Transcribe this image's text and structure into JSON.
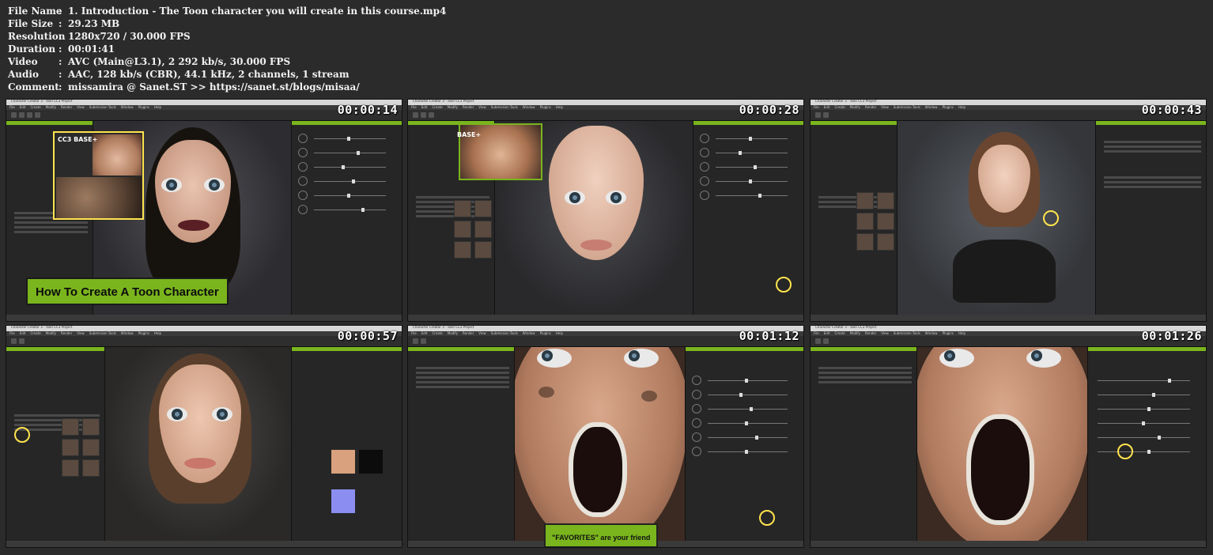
{
  "info": [
    {
      "key": "File Name",
      "value": "1. Introduction - The Toon character you will create in this course.mp4"
    },
    {
      "key": "File Size",
      "value": "29.23 MB"
    },
    {
      "key": "Resolution",
      "value": "1280x720 / 30.000 FPS"
    },
    {
      "key": "Duration",
      "value": "00:01:41"
    },
    {
      "key": "Video",
      "value": "AVC (Main@L3.1), 2 292 kb/s, 30.000 FPS"
    },
    {
      "key": "Audio",
      "value": "AAC, 128 kb/s (CBR), 44.1 kHz, 2 channels, 1 stream"
    },
    {
      "key": "Comment",
      "value": "missamira @ Sanet.ST  >> https://sanet.st/blogs/misaa/"
    }
  ],
  "separator": ":",
  "thumbnails": [
    {
      "timestamp": "00:00:14",
      "banner": "How To Create A Toon Character",
      "overlay_title": "CC3 BASE+"
    },
    {
      "timestamp": "00:00:28",
      "overlay_title": "BASE+"
    },
    {
      "timestamp": "00:00:43"
    },
    {
      "timestamp": "00:00:57"
    },
    {
      "timestamp": "00:01:12",
      "callout": "\"FAVORITES\" are your friend"
    },
    {
      "timestamp": "00:01:26"
    }
  ],
  "app": {
    "window_title": "Character Creator 3 - Toon CC3 Project",
    "menu": [
      "File",
      "Edit",
      "Create",
      "Modify",
      "Render",
      "View",
      "Submission Tools",
      "Window",
      "Plugins",
      "Help"
    ]
  },
  "colors": {
    "accent": "#7ab51d",
    "highlight": "#ffe44d",
    "background": "#2b2b2b"
  }
}
